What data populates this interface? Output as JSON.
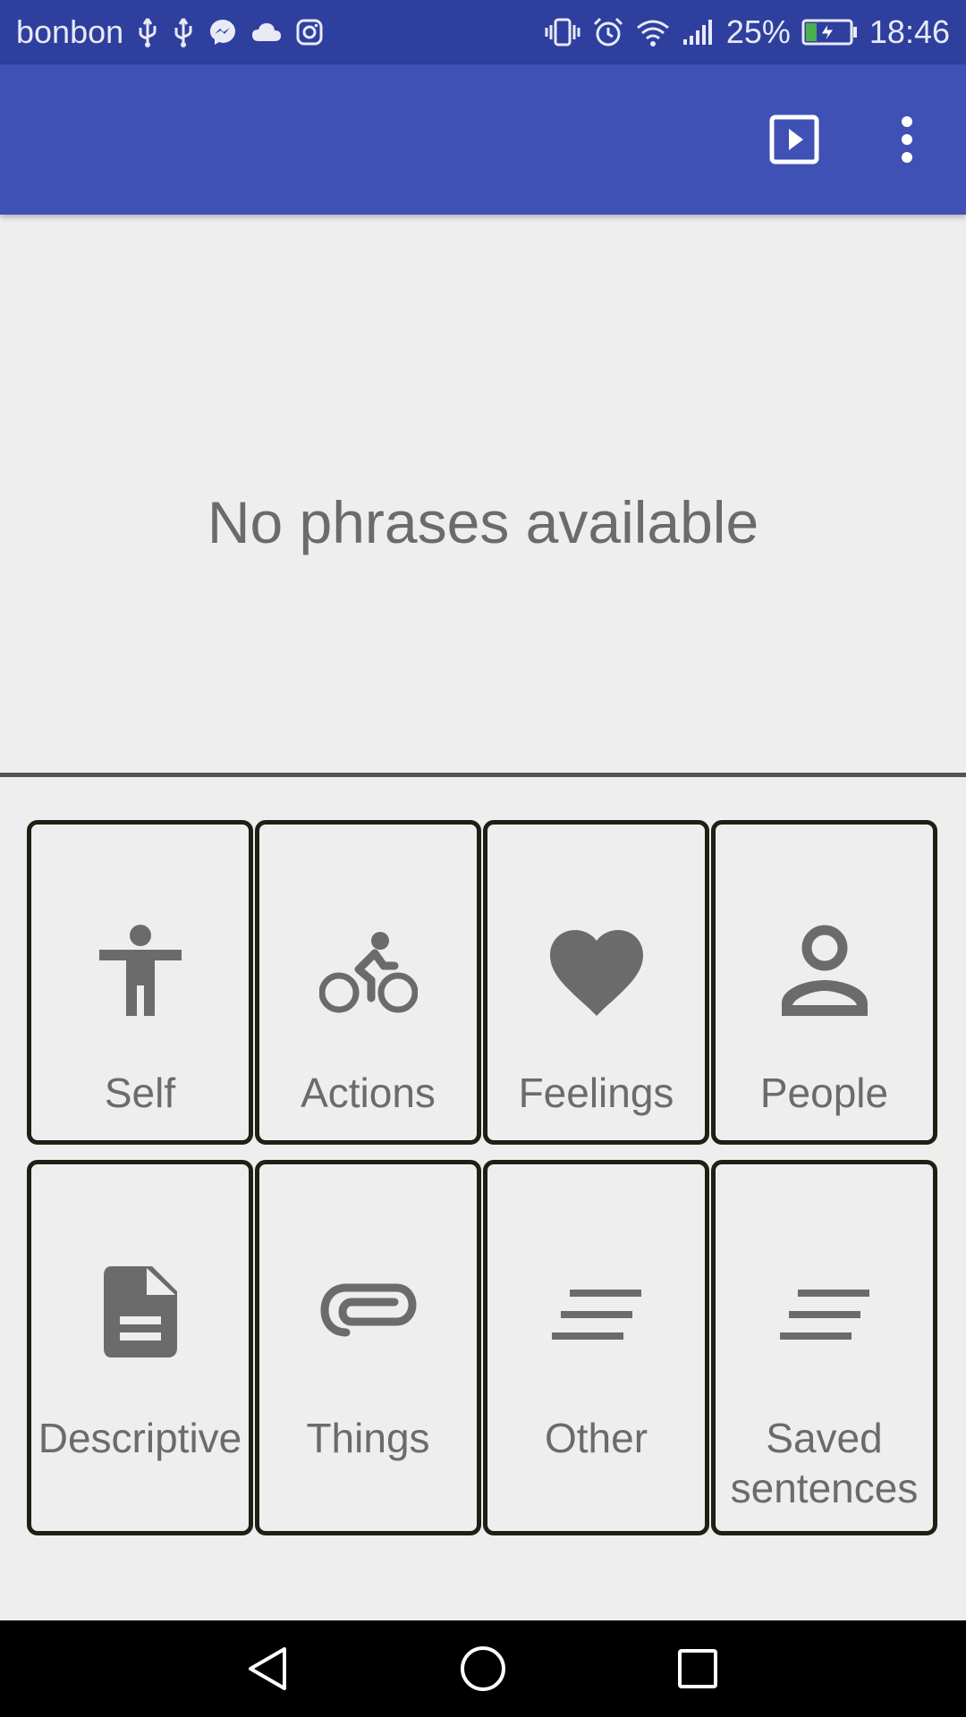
{
  "status_bar": {
    "carrier": "bonbon",
    "left_icons": [
      "usb-icon",
      "usb-icon",
      "messenger-icon",
      "cloud-icon",
      "instagram-icon"
    ],
    "right_icons": [
      "vibrate-icon",
      "alarm-icon",
      "wifi-icon",
      "signal-icon"
    ],
    "battery_percent": "25%",
    "battery_level": 0.25,
    "battery_charging": true,
    "time": "18:46"
  },
  "app_bar": {
    "actions": [
      "play-icon",
      "more-vert-icon"
    ]
  },
  "phrase_area": {
    "empty_message": "No phrases available"
  },
  "categories": [
    {
      "label": "Self",
      "icon": "accessibility-icon"
    },
    {
      "label": "Actions",
      "icon": "bike-icon"
    },
    {
      "label": "Feelings",
      "icon": "heart-icon"
    },
    {
      "label": "People",
      "icon": "person-icon"
    },
    {
      "label": "Descriptive",
      "icon": "document-icon"
    },
    {
      "label": "Things",
      "icon": "attachment-icon"
    },
    {
      "label": "Other",
      "icon": "short-text-icon"
    },
    {
      "label": "Saved\nsentences",
      "icon": "short-text-icon"
    }
  ],
  "nav_bar": {
    "buttons": [
      "back-icon",
      "home-icon",
      "recents-icon"
    ]
  },
  "colors": {
    "status_bar": "#2f3f9e",
    "app_bar": "#3f51b5",
    "background": "#eeeeee",
    "tile_border": "#1f1f14",
    "icon_gray": "#6b6b6b",
    "battery_green": "#4caf50"
  }
}
